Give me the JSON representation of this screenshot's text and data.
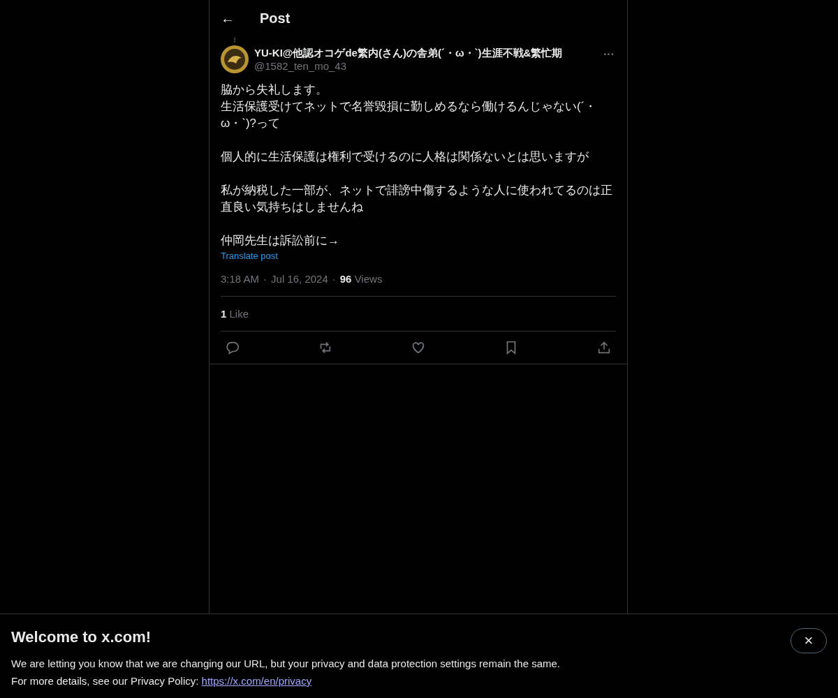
{
  "header": {
    "back": "←",
    "title": "Post"
  },
  "post": {
    "display_name": "YU-KI@他認オコゲde繁内(さん)の舎弟(´・ω・`)生涯不戦&繁忙期",
    "handle": "@1582_ten_mo_43",
    "more": "···",
    "paragraphs": [
      [
        "脇から失礼します。",
        "生活保護受けてネットで名誉毀損に勤しめるなら働けるんじゃない(´・ω・`)?って"
      ],
      [
        "個人的に生活保護は権利で受けるのに人格は関係ないとは思いますが"
      ],
      [
        "私が納税した一部が、ネットで誹謗中傷するような人に使われてるのは正直良い気持ちはしませんね"
      ],
      [
        "仲岡先生は訴訟前に→"
      ]
    ],
    "separator": "·",
    "translate": "Translate post",
    "time": "3:18 AM",
    "date": "Jul 16, 2024",
    "views_count": "96",
    "views_label": "Views",
    "likes_count": "1",
    "likes_label": "Like",
    "actions": [
      {
        "kind": "reply"
      },
      {
        "kind": "repost"
      },
      {
        "kind": "like"
      },
      {
        "kind": "bookmark"
      },
      {
        "kind": "share"
      }
    ]
  },
  "banner": {
    "title": "Welcome to x.com!",
    "line1": "We are letting you know that we are changing our URL, but your privacy and data protection settings remain the same.",
    "line2": "For more details, see our Privacy Policy: ",
    "link": "https://x.com/en/privacy",
    "close": "×"
  }
}
